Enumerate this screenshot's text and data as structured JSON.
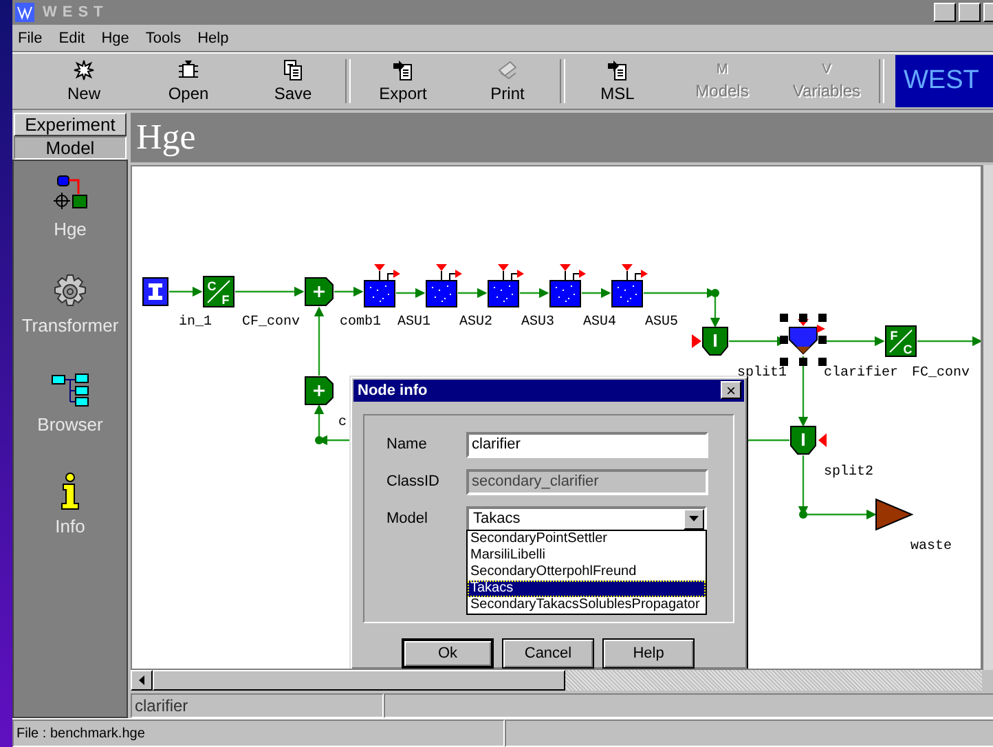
{
  "window": {
    "title": "WEST"
  },
  "menu": [
    {
      "label": "File"
    },
    {
      "label": "Edit"
    },
    {
      "label": "Hge"
    },
    {
      "label": "Tools"
    },
    {
      "label": "Help"
    }
  ],
  "toolbar": [
    {
      "kind": "new",
      "label": "New",
      "disabled": false
    },
    {
      "kind": "open",
      "label": "Open",
      "disabled": false
    },
    {
      "kind": "save",
      "label": "Save",
      "disabled": false
    },
    {
      "kind": "separator"
    },
    {
      "kind": "export",
      "label": "Export",
      "disabled": false
    },
    {
      "kind": "print",
      "label": "Print",
      "disabled": false
    },
    {
      "kind": "separator"
    },
    {
      "kind": "export",
      "label": "MSL",
      "disabled": false
    },
    {
      "kind": "glyph",
      "glyph": "M",
      "label": "Models",
      "disabled": true
    },
    {
      "kind": "glyph",
      "glyph": "V",
      "label": "Variables",
      "disabled": true
    }
  ],
  "logo": "WEST",
  "side_tabs": [
    {
      "label": "Experiment",
      "selected": false
    },
    {
      "label": "Model",
      "selected": true
    }
  ],
  "sidebar": {
    "items": [
      {
        "label": "Hge",
        "kind": "hge"
      },
      {
        "label": "Transformer",
        "kind": "gear"
      },
      {
        "label": "Browser",
        "kind": "tree"
      },
      {
        "label": "Info",
        "kind": "info"
      }
    ]
  },
  "page_title": "Hge",
  "diagram": {
    "nodes": [
      {
        "label": "in_1",
        "kind": "input",
        "selected": false
      },
      {
        "label": "CF_conv",
        "kind": "converter",
        "glyph": [
          "C",
          "F"
        ],
        "selected": false
      },
      {
        "label": "comb1",
        "kind": "combiner",
        "selected": false
      },
      {
        "label": "ASU1",
        "kind": "tank",
        "selected": false
      },
      {
        "label": "ASU2",
        "kind": "tank",
        "selected": false
      },
      {
        "label": "ASU3",
        "kind": "tank",
        "selected": false
      },
      {
        "label": "ASU4",
        "kind": "tank",
        "selected": false
      },
      {
        "label": "ASU5",
        "kind": "tank",
        "selected": false
      },
      {
        "label": "split1",
        "kind": "splitter",
        "selected": false
      },
      {
        "label": "clarifier",
        "kind": "clarifier",
        "selected": true
      },
      {
        "label": "FC_conv",
        "kind": "converter",
        "glyph": [
          "F",
          "C"
        ],
        "selected": false
      },
      {
        "label": "c",
        "kind": "combiner",
        "selected": false
      },
      {
        "label": "split2",
        "kind": "splitter",
        "selected": false
      },
      {
        "label": "waste",
        "kind": "waste",
        "selected": false
      }
    ]
  },
  "dialog": {
    "title": "Node info",
    "close": "×",
    "fields": [
      {
        "label": "Name",
        "kind": "text",
        "value": "clarifier",
        "disabled": false
      },
      {
        "label": "ClassID",
        "kind": "text",
        "value": "secondary_clarifier",
        "disabled": true
      },
      {
        "label": "Model",
        "kind": "select",
        "value": "Takacs",
        "expanded": true,
        "options": [
          {
            "label": "SecondaryPointSettler",
            "selected": false
          },
          {
            "label": "MarsiliLibelli",
            "selected": false
          },
          {
            "label": "SecondaryOtterpohlFreund",
            "selected": false
          },
          {
            "label": "Takacs",
            "selected": true
          },
          {
            "label": "SecondaryTakacsSolublesPropagator",
            "selected": false
          }
        ]
      }
    ],
    "buttons": [
      {
        "label": "Ok",
        "default": true
      },
      {
        "label": "Cancel",
        "default": false
      },
      {
        "label": "Help",
        "default": false
      }
    ]
  },
  "status_panel": "clarifier",
  "status_bar": "File : benchmark.hge"
}
